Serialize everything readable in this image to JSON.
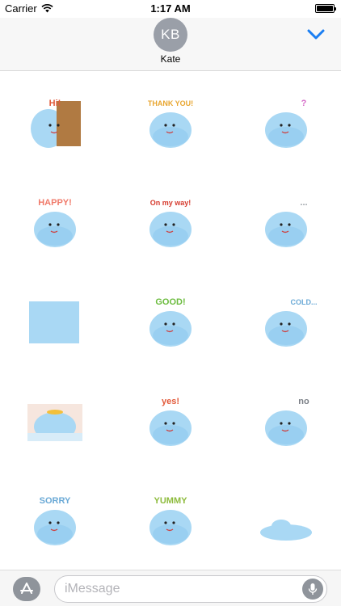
{
  "status_bar": {
    "carrier": "Carrier",
    "time": "1:17 AM",
    "battery_level": 1.0
  },
  "header": {
    "avatar_initials": "KB",
    "contact_name": "Kate",
    "collapse_icon": "chevron-down-icon",
    "accent_color": "#1a7ef2"
  },
  "stickers": [
    {
      "text": "Hi!",
      "icon": "monster-behind-door"
    },
    {
      "text": "THANK YOU!",
      "icon": "monster-with-flowers"
    },
    {
      "text": "?",
      "icon": "monster-confused"
    },
    {
      "text": "HAPPY!",
      "icon": "monster-happy"
    },
    {
      "text": "On my way!",
      "icon": "monster-walking-cane"
    },
    {
      "text": "...",
      "icon": "monster-thinking"
    },
    {
      "text": "",
      "icon": "monster-square"
    },
    {
      "text": "GOOD!",
      "icon": "monster-good"
    },
    {
      "text": "COLD...",
      "icon": "monster-cold"
    },
    {
      "text": "",
      "icon": "monster-in-bath"
    },
    {
      "text": "yes!",
      "icon": "monster-yes"
    },
    {
      "text": "no",
      "icon": "monster-no"
    },
    {
      "text": "SORRY",
      "icon": "monster-sorry"
    },
    {
      "text": "YUMMY",
      "icon": "monster-eating"
    },
    {
      "text": "",
      "icon": "monster-melted-puddle"
    }
  ],
  "composer": {
    "app_store_icon": "app-store-icon",
    "placeholder": "iMessage",
    "mic_icon": "microphone-icon"
  },
  "colors": {
    "monster_blue": "#a9d8f4",
    "monster_dark": "#7cc0ea"
  }
}
